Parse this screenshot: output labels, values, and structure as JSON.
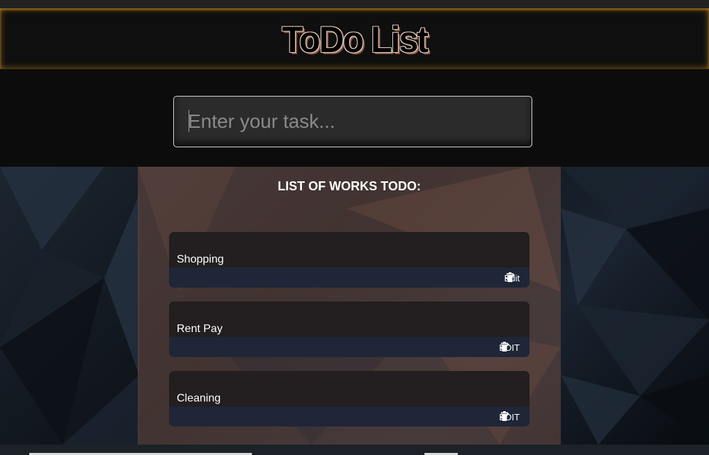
{
  "app": {
    "title": "ToDo List"
  },
  "input": {
    "placeholder": "Enter your task...",
    "value": ""
  },
  "list": {
    "heading": "LIST OF WORKS TODO:",
    "items": [
      {
        "text": "Shopping",
        "edit_label": "Edit",
        "check_icon": "check-icon",
        "delete_icon": "trash-icon"
      },
      {
        "text": "Rent Pay",
        "edit_label": "EDIT",
        "check_icon": "check-icon",
        "delete_icon": "trash-icon"
      },
      {
        "text": "Cleaning",
        "edit_label": "EDIT",
        "check_icon": "check-icon",
        "delete_icon": "trash-icon"
      }
    ]
  },
  "colors": {
    "header_glow": "#c88c1e",
    "panel": "#6e4e46",
    "item_bg": "#231e1f",
    "item_bar": "#1f2638"
  }
}
